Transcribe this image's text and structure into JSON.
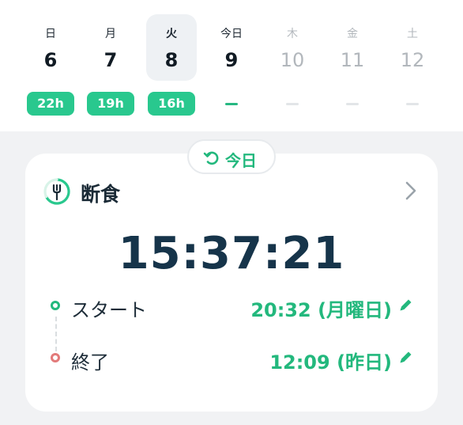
{
  "week": {
    "days": [
      {
        "dow": "日",
        "num": "6",
        "hours": "22h"
      },
      {
        "dow": "月",
        "num": "7",
        "hours": "19h"
      },
      {
        "dow": "火",
        "num": "8",
        "hours": "16h"
      },
      {
        "dow": "今日",
        "num": "9",
        "hours": ""
      },
      {
        "dow": "木",
        "num": "10",
        "hours": ""
      },
      {
        "dow": "金",
        "num": "11",
        "hours": ""
      },
      {
        "dow": "土",
        "num": "12",
        "hours": ""
      }
    ]
  },
  "today_chip": {
    "label": "今日",
    "icon": "rotate-back-icon"
  },
  "card": {
    "icon": "fork-progress-icon",
    "title": "断食",
    "timer": "15:37:21",
    "start": {
      "label": "スタート",
      "value": "20:32 (月曜日)"
    },
    "end": {
      "label": "終了",
      "value": "12:09 (昨日)"
    }
  },
  "colors": {
    "accent": "#29c88e",
    "timer_text": "#16344a",
    "end_dot": "#e27a7a",
    "background": "#f1f2f4"
  }
}
